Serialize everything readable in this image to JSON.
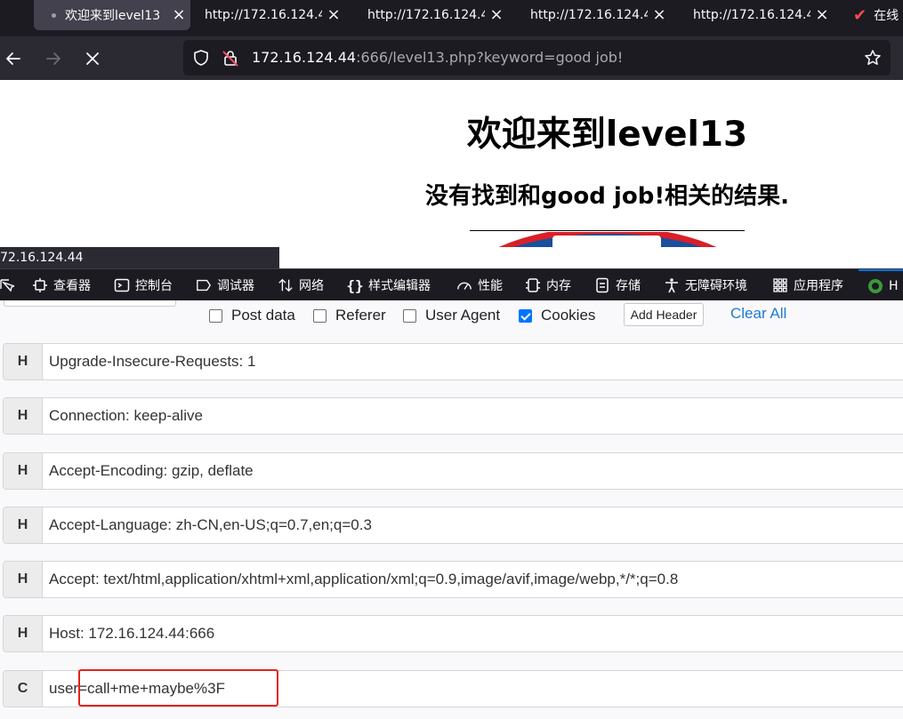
{
  "browser": {
    "tabs": [
      {
        "label": "欢迎来到level13",
        "active": true
      },
      {
        "label": "http://172.16.124.4",
        "active": false
      },
      {
        "label": "http://172.16.124.4",
        "active": false
      },
      {
        "label": "http://172.16.124.4",
        "active": false
      },
      {
        "label": "http://172.16.124.4",
        "active": false
      },
      {
        "label": "在线",
        "active": false
      }
    ],
    "url_host": "172.16.124.44",
    "url_rest": ":666/level13.php?keyword=good job!",
    "status_text": "72.16.124.44"
  },
  "page": {
    "title": "欢迎来到level13",
    "result": "没有找到和good job!相关的结果."
  },
  "devtools": {
    "tabs": [
      {
        "label": "查看器",
        "icon": "inspector-icon"
      },
      {
        "label": "控制台",
        "icon": "console-icon"
      },
      {
        "label": "调试器",
        "icon": "debugger-icon"
      },
      {
        "label": "网络",
        "icon": "network-icon"
      },
      {
        "label": "样式编辑器",
        "icon": "style-editor-icon"
      },
      {
        "label": "性能",
        "icon": "performance-icon"
      },
      {
        "label": "内存",
        "icon": "memory-icon"
      },
      {
        "label": "存储",
        "icon": "storage-icon"
      },
      {
        "label": "无障碍环境",
        "icon": "accessibility-icon"
      },
      {
        "label": "应用程序",
        "icon": "application-icon"
      },
      {
        "label": "H",
        "icon": "extension-icon"
      }
    ]
  },
  "header_editor": {
    "options": [
      {
        "label": "Post data",
        "checked": false
      },
      {
        "label": "Referer",
        "checked": false
      },
      {
        "label": "User Agent",
        "checked": false
      },
      {
        "label": "Cookies",
        "checked": true
      }
    ],
    "add_header_label": "Add Header",
    "clear_all_label": "Clear All",
    "rows": [
      {
        "type": "H",
        "value": "Upgrade-Insecure-Requests: 1"
      },
      {
        "type": "H",
        "value": "Connection: keep-alive"
      },
      {
        "type": "H",
        "value": "Accept-Encoding: gzip, deflate"
      },
      {
        "type": "H",
        "value": "Accept-Language: zh-CN,en-US;q=0.7,en;q=0.3"
      },
      {
        "type": "H",
        "value": "Accept: text/html,application/xhtml+xml,application/xml;q=0.9,image/avif,image/webp,*/*;q=0.8"
      },
      {
        "type": "H",
        "value": "Host: 172.16.124.44:666"
      },
      {
        "type": "C",
        "value": "user=call+me+maybe%3F"
      }
    ]
  },
  "colors": {
    "accent": "#0075ff",
    "link": "#1f7ad3",
    "highlight": "#e5211b"
  }
}
